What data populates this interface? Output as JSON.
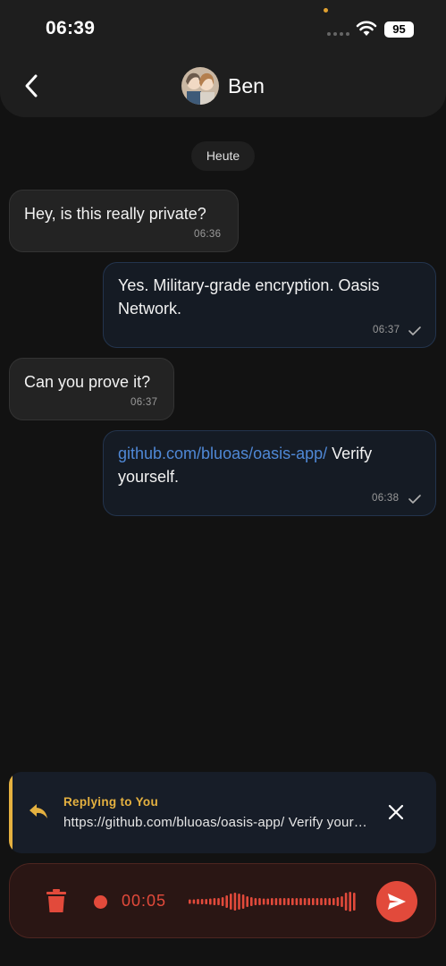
{
  "status_bar": {
    "time": "06:39",
    "battery": "95"
  },
  "header": {
    "contact_name": "Ben"
  },
  "date_chip": "Heute",
  "messages": [
    {
      "direction": "incoming",
      "text": "Hey, is this really private?",
      "time": "06:36"
    },
    {
      "direction": "outgoing",
      "text_line1": "Yes. Military-grade encryption. Oasis",
      "text_line2": "Network.",
      "time": "06:37"
    },
    {
      "direction": "incoming",
      "text": "Can you prove it?",
      "time": "06:37"
    },
    {
      "direction": "outgoing",
      "link": "github.com/bluoas/oasis-app/",
      "text_after_link": " Verify",
      "text_line2": "yourself.",
      "time": "06:38"
    }
  ],
  "reply_preview": {
    "title": "Replying to You",
    "snippet": "https://github.com/bluoas/oasis-app/ Verify yourself."
  },
  "recorder": {
    "elapsed": "00:05"
  },
  "colors": {
    "background": "#121212",
    "incoming_bubble": "#232323",
    "outgoing_bubble": "#151b24",
    "reply_accent": "#e5b140",
    "recording_red": "#e24a3b",
    "link": "#4f88d6"
  },
  "icons": {
    "back": "chevron-left-icon",
    "reply": "reply-arrow-icon",
    "close": "close-icon",
    "trash": "trash-icon",
    "record": "recording-dot-icon",
    "send": "send-icon",
    "read": "check-icon",
    "wifi": "wifi-icon"
  }
}
